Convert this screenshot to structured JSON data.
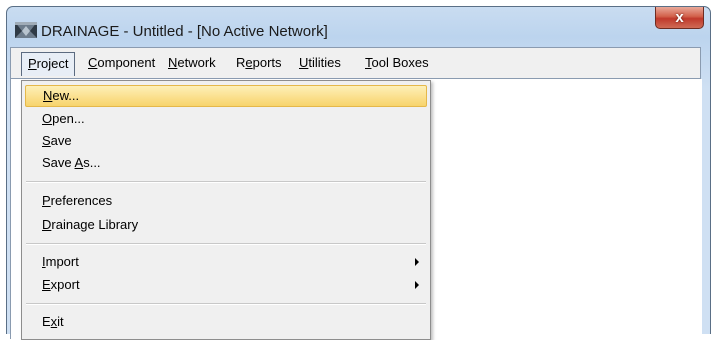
{
  "window": {
    "title": "DRAINAGE - Untitled - [No Active Network]",
    "close_label": "x"
  },
  "menubar": {
    "items": [
      {
        "mnemonic": "P",
        "rest": "roject"
      },
      {
        "mnemonic": "C",
        "rest": "omponent"
      },
      {
        "mnemonic": "N",
        "rest": "etwork"
      },
      {
        "pre": "R",
        "mnemonic": "e",
        "rest": "ports"
      },
      {
        "mnemonic": "U",
        "rest": "tilities"
      },
      {
        "mnemonic": "T",
        "rest": "ool Boxes"
      }
    ]
  },
  "project_menu": {
    "items": [
      {
        "pre": "",
        "mnemonic": "N",
        "rest": "ew..."
      },
      {
        "pre": "",
        "mnemonic": "O",
        "rest": "pen..."
      },
      {
        "pre": "",
        "mnemonic": "S",
        "rest": "ave"
      },
      {
        "pre": "Save ",
        "mnemonic": "A",
        "rest": "s..."
      },
      {
        "pre": "",
        "mnemonic": "P",
        "rest": "references"
      },
      {
        "pre": "",
        "mnemonic": "D",
        "rest": "rainage Library"
      },
      {
        "pre": "",
        "mnemonic": "I",
        "rest": "mport"
      },
      {
        "pre": "",
        "mnemonic": "E",
        "rest": "xport"
      },
      {
        "pre": "E",
        "mnemonic": "x",
        "rest": "it"
      }
    ]
  }
}
